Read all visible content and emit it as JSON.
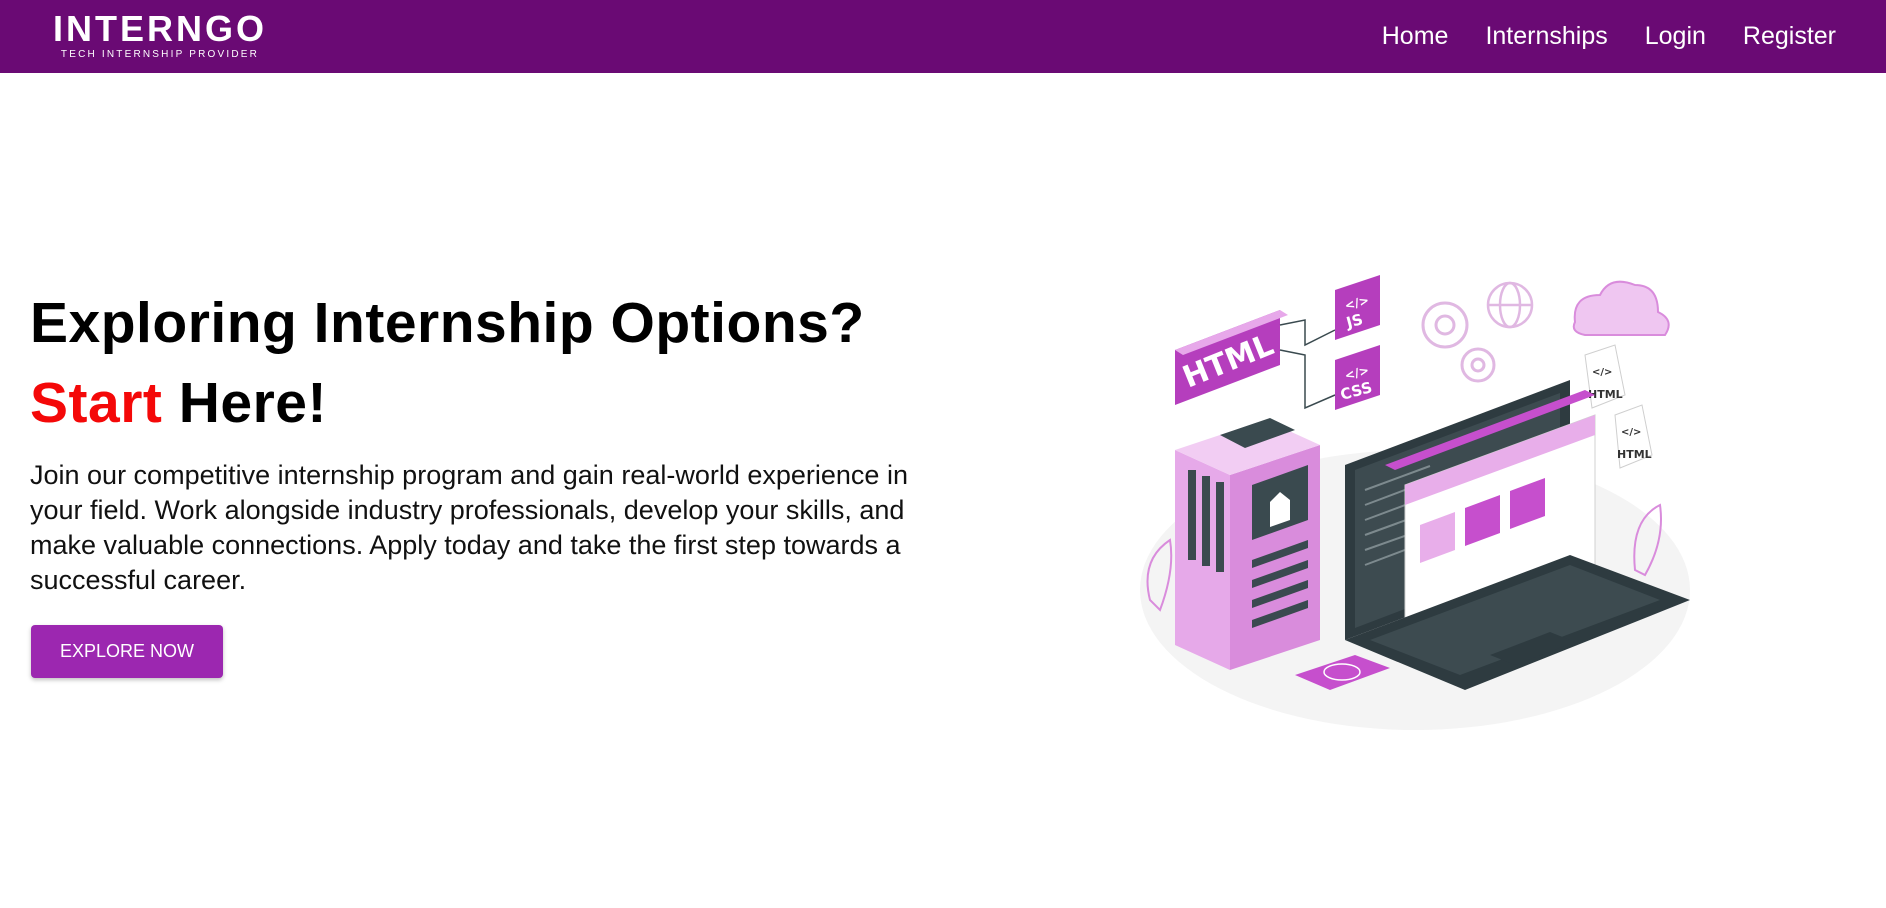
{
  "brand": {
    "name": "INTERNGO",
    "tagline": "TECH INTERNSHIP PROVIDER"
  },
  "nav": {
    "items": [
      "Home",
      "Internships",
      "Login",
      "Register"
    ]
  },
  "hero": {
    "title_line1": "Exploring Internship Options?",
    "title_accent": "Start",
    "title_rest": " Here!",
    "description": "Join our competitive internship program and gain real-world experience in your field. Work alongside industry professionals, develop your skills, and make valuable connections. Apply today and take the first step towards a successful career.",
    "cta_label": "EXPLORE NOW"
  },
  "illustration": {
    "html_badge": "HTML",
    "js_badge": "JS",
    "css_badge": "CSS",
    "code_symbol": "</>",
    "doc_label": "HTML"
  },
  "colors": {
    "navbar": "#6a0a74",
    "accent_red": "#f40808",
    "button": "#9c27b0",
    "illustration_pink": "#c64fcd"
  },
  "icons": [
    "house-icon",
    "globe-icon",
    "gear-icon",
    "cloud-icon",
    "image-icon",
    "code-icon"
  ]
}
